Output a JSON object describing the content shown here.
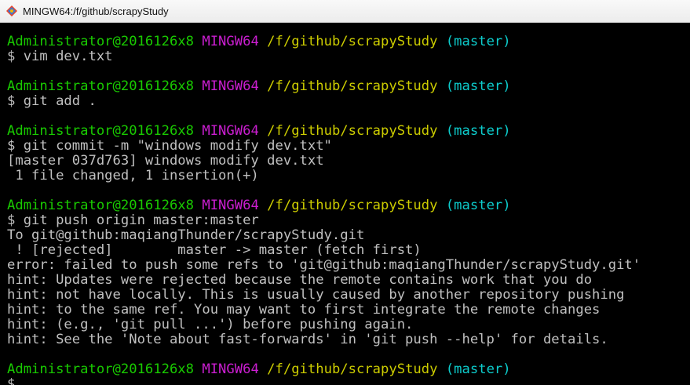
{
  "window": {
    "title": "MINGW64:/f/github/scrapyStudy",
    "icon": "mingw-git-icon"
  },
  "colors": {
    "background": "#000000",
    "text": "#c0c0c0",
    "user": "#19cb00",
    "system": "#cb1ed1",
    "path": "#cdcd00",
    "branch": "#0dcdcd"
  },
  "prompt": {
    "user_host": "Administrator@2016126x8",
    "system": "MINGW64",
    "path": "/f/github/scrapyStudy",
    "branch": "(master)",
    "symbol": "$"
  },
  "terminal": {
    "blocks": [
      {
        "command": "$ vim dev.txt",
        "output": []
      },
      {
        "command": "$ git add .",
        "output": []
      },
      {
        "command": "$ git commit -m \"windows modify dev.txt\"",
        "output": [
          "[master 037d763] windows modify dev.txt",
          " 1 file changed, 1 insertion(+)"
        ]
      },
      {
        "command": "$ git push origin master:master",
        "output": [
          "To git@github:maqiangThunder/scrapyStudy.git",
          " ! [rejected]        master -> master (fetch first)",
          "error: failed to push some refs to 'git@github:maqiangThunder/scrapyStudy.git'",
          "hint: Updates were rejected because the remote contains work that you do",
          "hint: not have locally. This is usually caused by another repository pushing",
          "hint: to the same ref. You may want to first integrate the remote changes",
          "hint: (e.g., 'git pull ...') before pushing again.",
          "hint: See the 'Note about fast-forwards' in 'git push --help' for details."
        ]
      },
      {
        "command": "$",
        "output": []
      }
    ]
  }
}
